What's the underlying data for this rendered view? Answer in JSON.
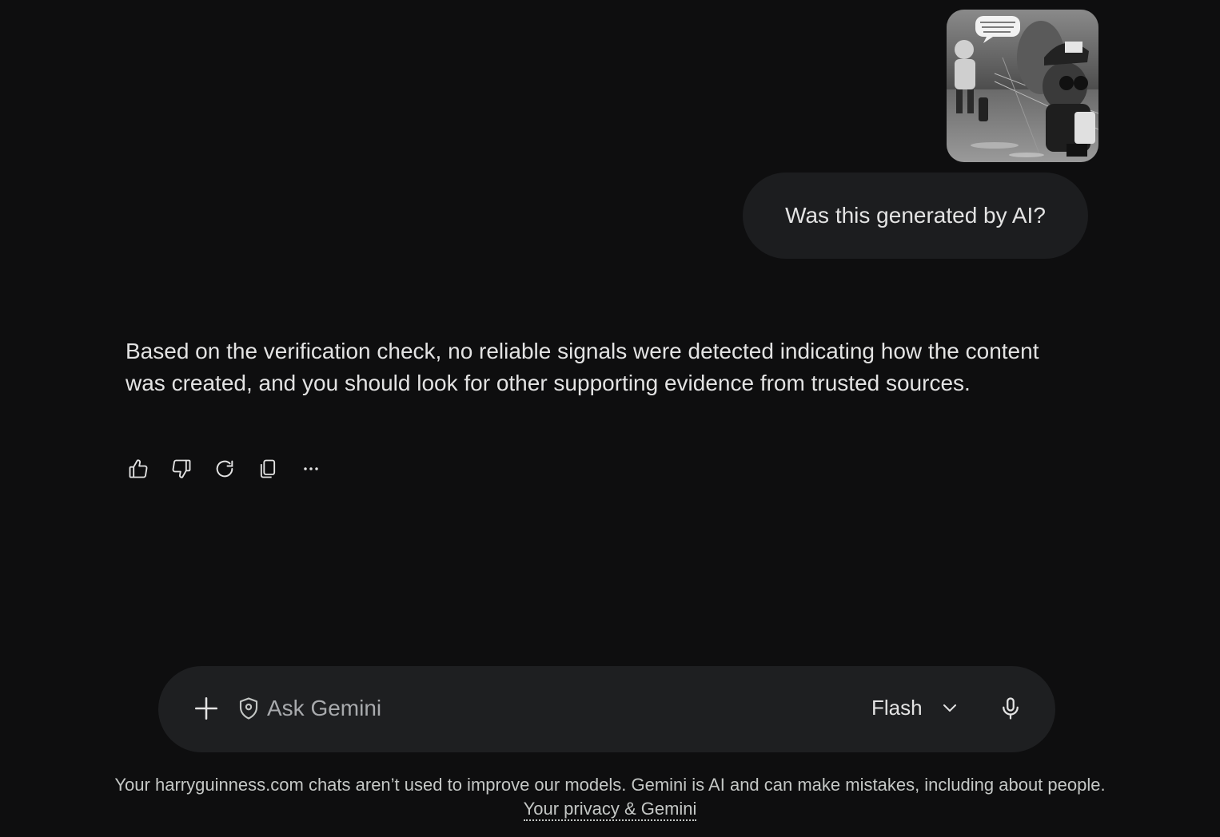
{
  "user_message": {
    "image_alt": "Attached image",
    "text": "Was this generated by AI?"
  },
  "response": {
    "text": "Based on the verification check, no reliable signals were detected indicating how the content was created, and you should look for other supporting evidence from trusted sources."
  },
  "response_actions": [
    {
      "name": "good-response",
      "icon": "thumbs-up-icon"
    },
    {
      "name": "bad-response",
      "icon": "thumbs-down-icon"
    },
    {
      "name": "redo",
      "icon": "refresh-icon"
    },
    {
      "name": "copy",
      "icon": "copy-icon"
    },
    {
      "name": "more",
      "icon": "more-horizontal-icon"
    }
  ],
  "input": {
    "placeholder": "Ask Gemini",
    "value": "",
    "model_label": "Flash"
  },
  "footer": {
    "disclaimer": "Your harryguinness.com chats aren’t used to improve our models. Gemini is AI and can make mistakes, including about people.",
    "privacy_link": "Your privacy & Gemini"
  },
  "colors": {
    "background": "#0e0e0f",
    "bubble": "#1c1d1f",
    "input_bar": "#1e1f21",
    "text": "#e3e3e3",
    "muted_text": "#c4c7c5"
  }
}
